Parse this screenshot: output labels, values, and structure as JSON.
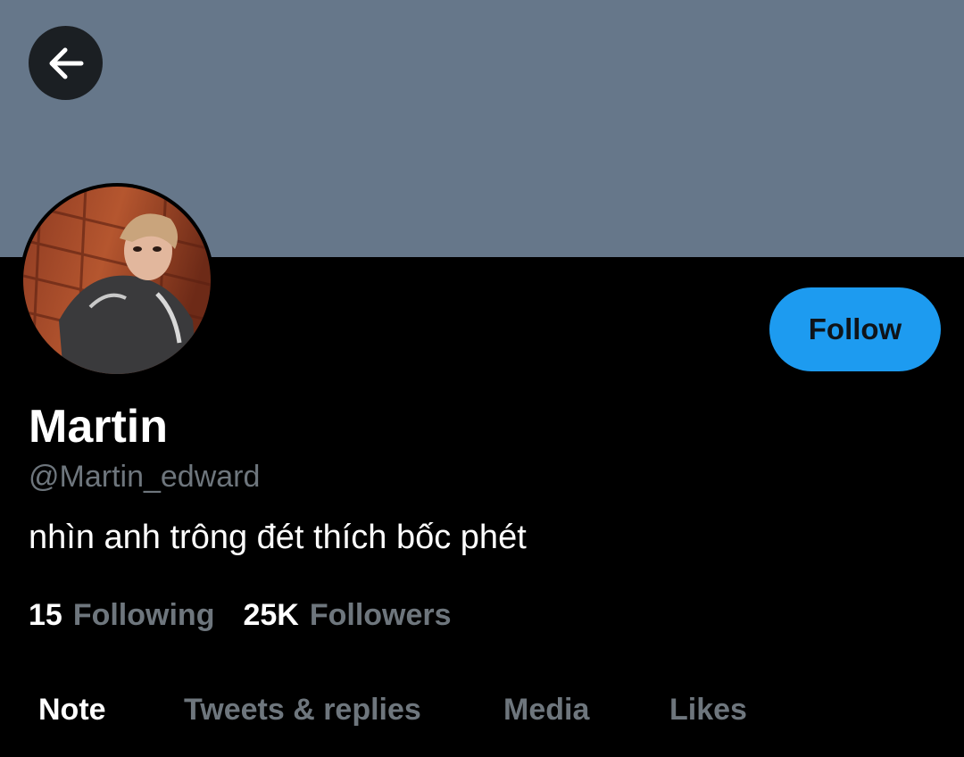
{
  "banner": {
    "color": "#66778a"
  },
  "nav": {
    "back_icon": "arrow-left-icon"
  },
  "profile": {
    "display_name": "Martin",
    "handle": "@Martin_edward",
    "bio": "nhìn anh trông đét thích bốc phét",
    "avatar_icon": "profile-photo"
  },
  "actions": {
    "follow_label": "Follow",
    "accent": "#1d9bf0"
  },
  "stats": {
    "following_count": "15",
    "following_label": "Following",
    "followers_count": "25K",
    "followers_label": "Followers"
  },
  "tabs": [
    {
      "label": "Note",
      "active": true
    },
    {
      "label": "Tweets & replies",
      "active": false
    },
    {
      "label": "Media",
      "active": false
    },
    {
      "label": "Likes",
      "active": false
    }
  ]
}
